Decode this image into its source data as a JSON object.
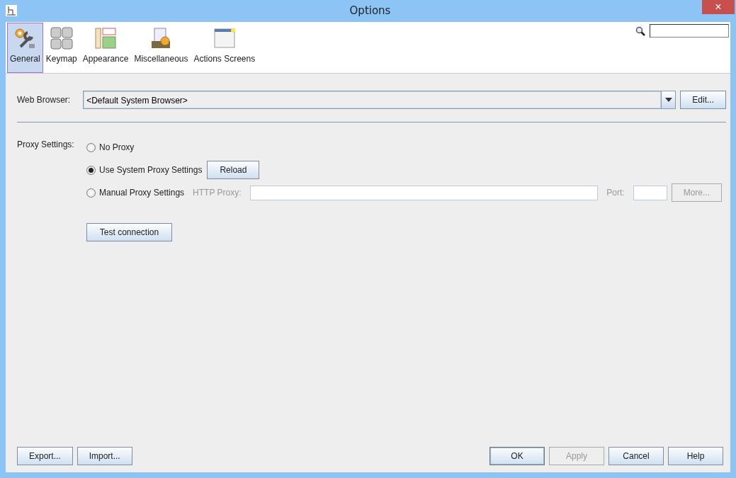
{
  "window": {
    "title": "Options",
    "close": "×"
  },
  "categories": [
    {
      "label": "General",
      "kind": "general",
      "selected": true
    },
    {
      "label": "Keymap",
      "kind": "keymap",
      "selected": false
    },
    {
      "label": "Appearance",
      "kind": "appearance",
      "selected": false
    },
    {
      "label": "Miscellaneous",
      "kind": "misc",
      "selected": false
    },
    {
      "label": "Actions Screens",
      "kind": "screens",
      "selected": false
    }
  ],
  "web_browser": {
    "label": "Web Browser:",
    "value": "<Default System Browser>",
    "button": "Edit..."
  },
  "proxy": {
    "label": "Proxy Settings:",
    "options": [
      {
        "label": "No Proxy",
        "selected": false
      },
      {
        "label": "Use System Proxy Settings",
        "selected": true,
        "button": "Reload"
      },
      {
        "label": "Manual Proxy Settings",
        "selected": false,
        "http_label": "HTTP Proxy:",
        "port_label": "Port:",
        "more_button": "More...",
        "disabled": true
      }
    ],
    "test_button": "Test connection"
  },
  "footer": {
    "left": [
      {
        "label": "Export...",
        "disabled": false
      },
      {
        "label": "Import...",
        "disabled": false
      }
    ],
    "right": [
      {
        "label": "OK",
        "disabled": false,
        "default": true
      },
      {
        "label": "Apply",
        "disabled": true,
        "default": false
      },
      {
        "label": "Cancel",
        "disabled": false,
        "default": false
      },
      {
        "label": "Help",
        "disabled": false,
        "default": false
      }
    ]
  }
}
